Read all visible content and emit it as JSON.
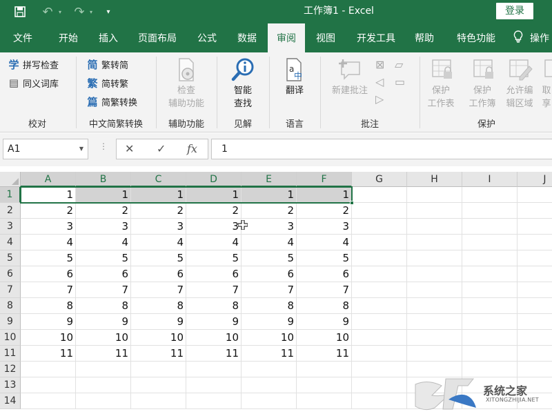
{
  "window": {
    "title": "工作簿1 - Excel",
    "login": "登录"
  },
  "quick_access": {
    "save_icon": "save-icon",
    "undo_icon": "undo-icon",
    "redo_icon": "redo-icon"
  },
  "tabs": [
    "文件",
    "开始",
    "插入",
    "页面布局",
    "公式",
    "数据",
    "审阅",
    "视图",
    "开发工具",
    "帮助",
    "特色功能"
  ],
  "active_tab": "审阅",
  "tell_me": "操作",
  "ribbon": {
    "proofing": {
      "label": "校对",
      "spell": "拼写检查",
      "thesaurus": "同义词库"
    },
    "chinese": {
      "label": "中文简繁转换",
      "to_trad": "繁转简",
      "to_simp": "简转繁",
      "convert": "简繁转换"
    },
    "accessibility": {
      "label": "辅助功能",
      "btn_line1": "检查",
      "btn_line2": "辅助功能"
    },
    "insights": {
      "label": "见解",
      "btn_line1": "智能",
      "btn_line2": "查找"
    },
    "language": {
      "label": "语言",
      "btn": "翻译"
    },
    "comments": {
      "label": "批注",
      "new": "新建批注"
    },
    "protect": {
      "label": "保护",
      "sheet1": "保护",
      "sheet2": "工作表",
      "book1": "保护",
      "book2": "工作簿",
      "range1": "允许编",
      "range2": "辑区域",
      "share1": "取",
      "share2": "享"
    }
  },
  "formula_bar": {
    "name_box": "A1",
    "cancel": "✕",
    "enter": "✓",
    "fx": "fx",
    "value": "1"
  },
  "columns": [
    "A",
    "B",
    "C",
    "D",
    "E",
    "F",
    "G",
    "H",
    "I",
    "J"
  ],
  "rows": [
    "1",
    "2",
    "3",
    "4",
    "5",
    "6",
    "7",
    "8",
    "9",
    "10",
    "11",
    "12",
    "13",
    "14"
  ],
  "cells": [
    [
      "1",
      "1",
      "1",
      "1",
      "1",
      "1"
    ],
    [
      "2",
      "2",
      "2",
      "2",
      "2",
      "2"
    ],
    [
      "3",
      "3",
      "3",
      "3",
      "3",
      "3"
    ],
    [
      "4",
      "4",
      "4",
      "4",
      "4",
      "4"
    ],
    [
      "5",
      "5",
      "5",
      "5",
      "5",
      "5"
    ],
    [
      "6",
      "6",
      "6",
      "6",
      "6",
      "6"
    ],
    [
      "7",
      "7",
      "7",
      "7",
      "7",
      "7"
    ],
    [
      "8",
      "8",
      "8",
      "8",
      "8",
      "8"
    ],
    [
      "9",
      "9",
      "9",
      "9",
      "9",
      "9"
    ],
    [
      "10",
      "10",
      "10",
      "10",
      "10",
      "10"
    ],
    [
      "11",
      "11",
      "11",
      "11",
      "11",
      "11"
    ]
  ],
  "watermark": {
    "name": "系统之家",
    "url": "XITONGZHIJIA.NET"
  },
  "colors": {
    "accent": "#217346",
    "ribbon_bg": "#f3f3f3",
    "header_bg": "#e6e6e6",
    "selection_bg": "#d3d3d3"
  }
}
